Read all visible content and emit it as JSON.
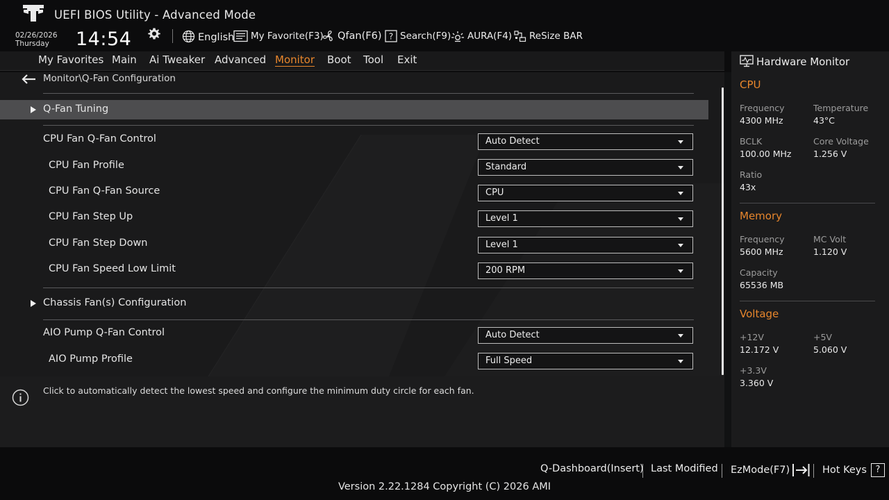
{
  "header": {
    "title": "UEFI BIOS Utility - Advanced Mode",
    "date": "02/26/2026",
    "day": "Thursday",
    "time": "14:54",
    "tools": {
      "language": "English",
      "favorite": "My Favorite(F3)",
      "qfan": "Qfan(F6)",
      "search": "Search(F9)",
      "aura": "AURA(F4)",
      "resize": "ReSize BAR"
    }
  },
  "menu": [
    {
      "label": "My Favorites"
    },
    {
      "label": "Main"
    },
    {
      "label": "Ai Tweaker"
    },
    {
      "label": "Advanced"
    },
    {
      "label": "Monitor",
      "active": true
    },
    {
      "label": "Boot"
    },
    {
      "label": "Tool"
    },
    {
      "label": "Exit"
    }
  ],
  "breadcrumb": "Monitor\\Q-Fan Configuration",
  "rows": {
    "qfan_tuning": "Q-Fan Tuning",
    "cpu_fan_control": {
      "label": "CPU Fan Q-Fan Control",
      "value": "Auto Detect"
    },
    "cpu_fan_profile": {
      "label": "CPU Fan Profile",
      "value": "Standard"
    },
    "cpu_fan_source": {
      "label": "CPU Fan Q-Fan Source",
      "value": "CPU"
    },
    "cpu_fan_step_up": {
      "label": "CPU Fan Step Up",
      "value": "Level 1"
    },
    "cpu_fan_step_down": {
      "label": "CPU Fan Step Down",
      "value": "Level 1"
    },
    "cpu_fan_low_limit": {
      "label": "CPU Fan Speed Low Limit",
      "value": "200 RPM"
    },
    "chassis_config": "Chassis Fan(s) Configuration",
    "aio_pump_control": {
      "label": "AIO Pump Q-Fan Control",
      "value": "Auto Detect"
    },
    "aio_pump_profile": {
      "label": "AIO Pump Profile",
      "value": "Full Speed"
    }
  },
  "help_text": "Click to automatically detect the lowest speed and configure the minimum duty circle for each fan.",
  "hardware_monitor": {
    "title": "Hardware Monitor",
    "cpu": {
      "title": "CPU",
      "frequency_label": "Frequency",
      "frequency": "4300 MHz",
      "temperature_label": "Temperature",
      "temperature": "43°C",
      "bclk_label": "BCLK",
      "bclk": "100.00 MHz",
      "core_voltage_label": "Core Voltage",
      "core_voltage": "1.256 V",
      "ratio_label": "Ratio",
      "ratio": "43x"
    },
    "memory": {
      "title": "Memory",
      "frequency_label": "Frequency",
      "frequency": "5600 MHz",
      "mc_volt_label": "MC Volt",
      "mc_volt": "1.120 V",
      "capacity_label": "Capacity",
      "capacity": "65536 MB"
    },
    "voltage": {
      "title": "Voltage",
      "v12_label": "+12V",
      "v12": "12.172 V",
      "v5_label": "+5V",
      "v5": "5.060 V",
      "v33_label": "+3.3V",
      "v33": "3.360 V"
    }
  },
  "footer": {
    "qdashboard": "Q-Dashboard(Insert)",
    "last_modified": "Last Modified",
    "ezmode": "EzMode(F7)",
    "hotkeys": "Hot Keys",
    "hotkeys_glyph": "?",
    "version": "Version 2.22.1284 Copyright (C) 2026 AMI"
  },
  "colors": {
    "accent": "#e7862c",
    "background": "#111213",
    "selected_row": "#4d4d4f"
  }
}
